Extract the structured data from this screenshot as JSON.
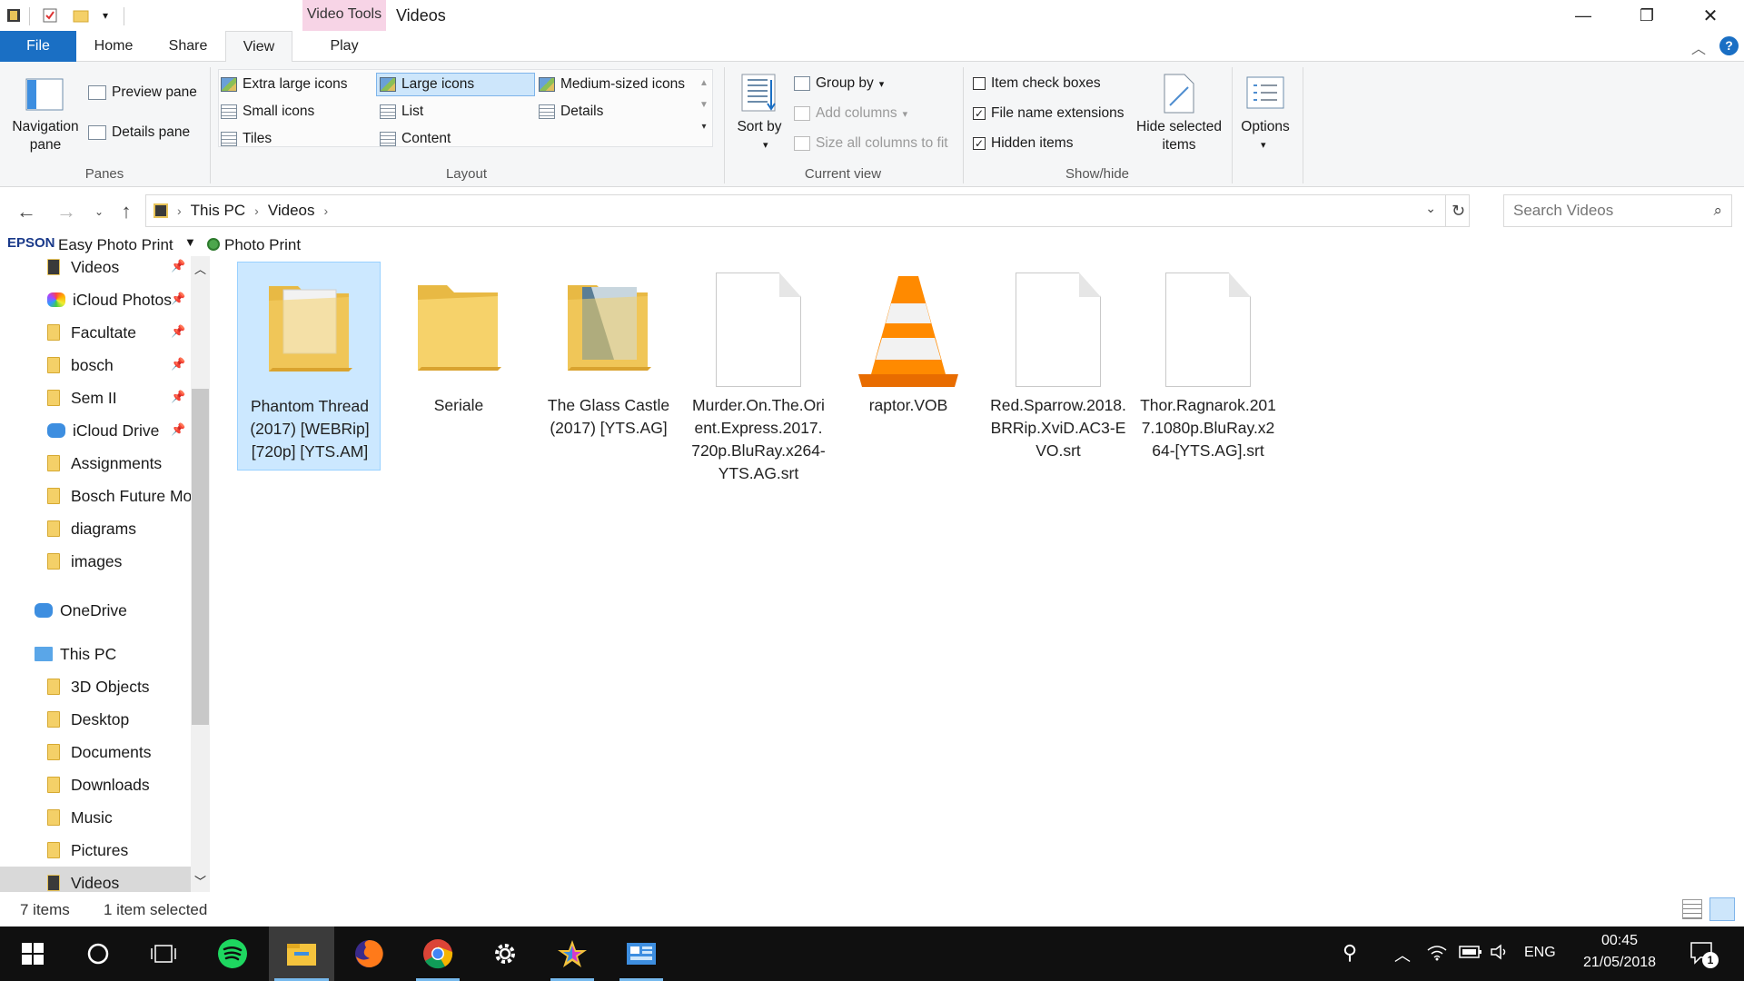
{
  "window": {
    "title": "Videos",
    "context_tab": "Video Tools",
    "controls": {
      "minimize": "—",
      "restore": "❐",
      "close": "✕"
    }
  },
  "ribbon_tabs": [
    "File",
    "Home",
    "Share",
    "View",
    "Play"
  ],
  "ribbon": {
    "panes": {
      "navigation_pane": "Navigation pane",
      "preview_pane": "Preview pane",
      "details_pane": "Details pane",
      "group_label": "Panes"
    },
    "layout": {
      "items": [
        "Extra large icons",
        "Large icons",
        "Medium-sized icons",
        "Small icons",
        "List",
        "Details",
        "Tiles",
        "Content"
      ],
      "selected": "Large icons",
      "group_label": "Layout"
    },
    "current_view": {
      "sort_by": "Sort by",
      "group_by": "Group by",
      "add_columns": "Add columns",
      "size_columns": "Size all columns to fit",
      "group_label": "Current view"
    },
    "show_hide": {
      "item_check_boxes": {
        "label": "Item check boxes",
        "checked": false
      },
      "file_name_extensions": {
        "label": "File name extensions",
        "checked": true
      },
      "hidden_items": {
        "label": "Hidden items",
        "checked": true
      },
      "hide_selected": "Hide selected items",
      "group_label": "Show/hide"
    },
    "options": "Options"
  },
  "address": {
    "crumbs": [
      "This PC",
      "Videos"
    ],
    "search_placeholder": "Search Videos"
  },
  "epson_toolbar": {
    "brand": "EPSON",
    "app": "Easy Photo Print",
    "photo_print": "Photo Print"
  },
  "nav_pane": {
    "items": [
      {
        "label": "Videos",
        "pinned": true,
        "icon": "video-folder-icon"
      },
      {
        "label": "iCloud Photos",
        "pinned": true,
        "icon": "icloud-photos-icon"
      },
      {
        "label": "Facultate",
        "pinned": true,
        "icon": "folder-icon"
      },
      {
        "label": "bosch",
        "pinned": true,
        "icon": "folder-icon"
      },
      {
        "label": "Sem II",
        "pinned": true,
        "icon": "folder-icon"
      },
      {
        "label": "iCloud Drive",
        "pinned": true,
        "icon": "icloud-drive-icon"
      },
      {
        "label": "Assignments",
        "pinned": false,
        "icon": "folder-icon"
      },
      {
        "label": "Bosch Future Mobility",
        "pinned": false,
        "icon": "folder-icon"
      },
      {
        "label": "diagrams",
        "pinned": false,
        "icon": "folder-icon"
      },
      {
        "label": "images",
        "pinned": false,
        "icon": "folder-icon"
      },
      {
        "label": "OneDrive",
        "pinned": false,
        "icon": "onedrive-icon"
      },
      {
        "label": "This PC",
        "pinned": false,
        "icon": "this-pc-icon"
      },
      {
        "label": "3D Objects",
        "pinned": false,
        "icon": "folder-icon"
      },
      {
        "label": "Desktop",
        "pinned": false,
        "icon": "folder-icon"
      },
      {
        "label": "Documents",
        "pinned": false,
        "icon": "folder-icon"
      },
      {
        "label": "Downloads",
        "pinned": false,
        "icon": "folder-icon"
      },
      {
        "label": "Music",
        "pinned": false,
        "icon": "folder-icon"
      },
      {
        "label": "Pictures",
        "pinned": false,
        "icon": "folder-icon"
      },
      {
        "label": "Videos",
        "pinned": false,
        "icon": "video-folder-icon"
      }
    ]
  },
  "files": [
    {
      "name": "Phantom Thread (2017) [WEBRip] [720p] [YTS.AM]",
      "type": "folder",
      "selected": true
    },
    {
      "name": "Seriale",
      "type": "folder",
      "selected": false
    },
    {
      "name": "The Glass Castle (2017) [YTS.AG]",
      "type": "folder",
      "selected": false
    },
    {
      "name": "Murder.On.The.Orient.Express.2017.720p.BluRay.x264-YTS.AG.srt",
      "type": "document",
      "selected": false
    },
    {
      "name": "raptor.VOB",
      "type": "vlc",
      "selected": false
    },
    {
      "name": "Red.Sparrow.2018.BRRip.XviD.AC3-EVO.srt",
      "type": "document",
      "selected": false
    },
    {
      "name": "Thor.Ragnarok.2017.1080p.BluRay.x264-[YTS.AG].srt",
      "type": "document",
      "selected": false
    }
  ],
  "status": {
    "item_count": "7 items",
    "selection": "1 item selected"
  },
  "taskbar": {
    "language": "ENG",
    "time": "00:45",
    "date": "21/05/2018",
    "notifications": "1"
  },
  "colors": {
    "accent": "#1a6fc4",
    "selection": "#cce8ff",
    "context_tab": "#f7d4e6",
    "taskbar": "#101010"
  }
}
